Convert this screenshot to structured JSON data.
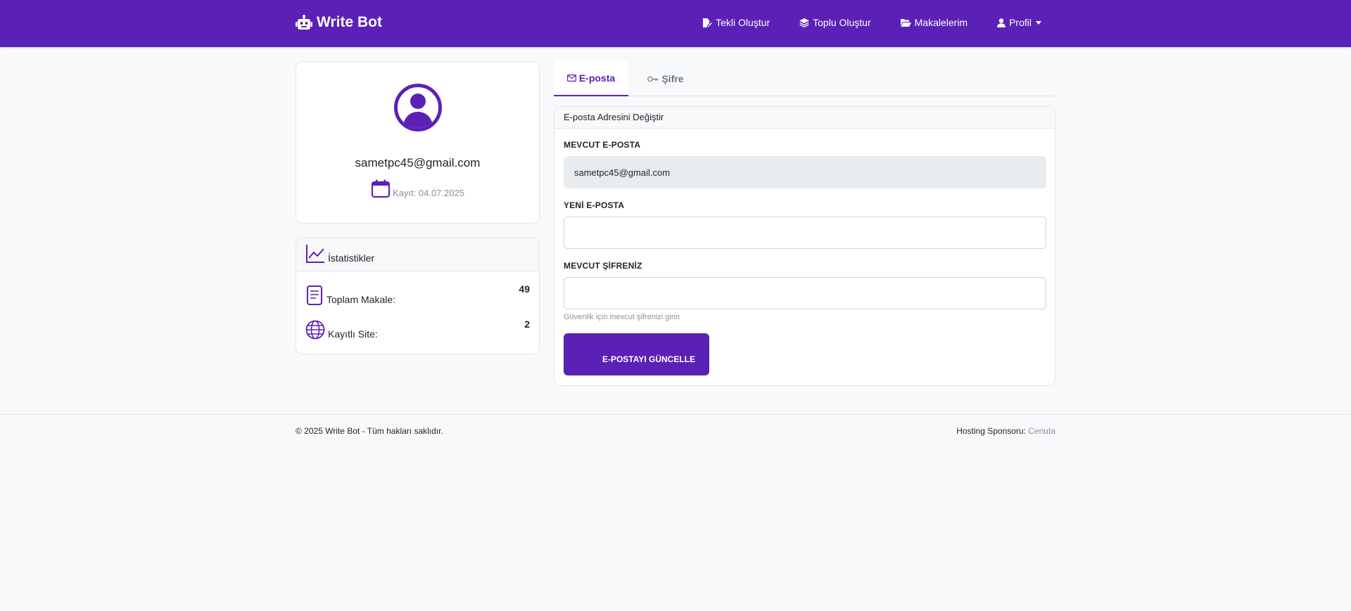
{
  "navbar": {
    "brand": "Write Bot",
    "links": [
      {
        "label": "Tekli Oluştur",
        "icon": "file-pen-icon"
      },
      {
        "label": "Toplu Oluştur",
        "icon": "layers-icon"
      },
      {
        "label": "Makalelerim",
        "icon": "folder-open-icon"
      },
      {
        "label": "Profil",
        "icon": "user-icon"
      }
    ]
  },
  "profile": {
    "email": "sametpc45@gmail.com",
    "joined": "Kayıt: 04.07.2025"
  },
  "stats": {
    "title": "İstatistikler",
    "items": [
      {
        "label": "Toplam Makale:",
        "value": "49",
        "icon": "document-icon"
      },
      {
        "label": "Kayıtlı Site:",
        "value": "2",
        "icon": "globe-icon"
      }
    ]
  },
  "tabs": [
    {
      "label": "E-posta",
      "icon": "envelope-icon",
      "active": true
    },
    {
      "label": "Şifre",
      "icon": "key-icon",
      "active": false
    }
  ],
  "form": {
    "title": "E-posta Adresini Değiştir",
    "current_label": "MEVCUT E-POSTA",
    "current_value": "sametpc45@gmail.com",
    "new_label": "YENİ E-POSTA",
    "new_value": "",
    "password_label": "MEVCUT ŞİFRENİZ",
    "password_value": "",
    "password_hint": "Güvenlik için mevcut şifrenizi girin",
    "submit": "E-POSTAYI GÜNCELLE"
  },
  "footer": {
    "copyright": "© 2025 Write Bot - Tüm hakları saklıdır.",
    "sponsor_label": "Hosting Sponsoru:",
    "sponsor_name": "Cenuta"
  },
  "colors": {
    "primary": "#5b21b6",
    "background": "#f8f9fb",
    "muted": "#8a8f99"
  }
}
